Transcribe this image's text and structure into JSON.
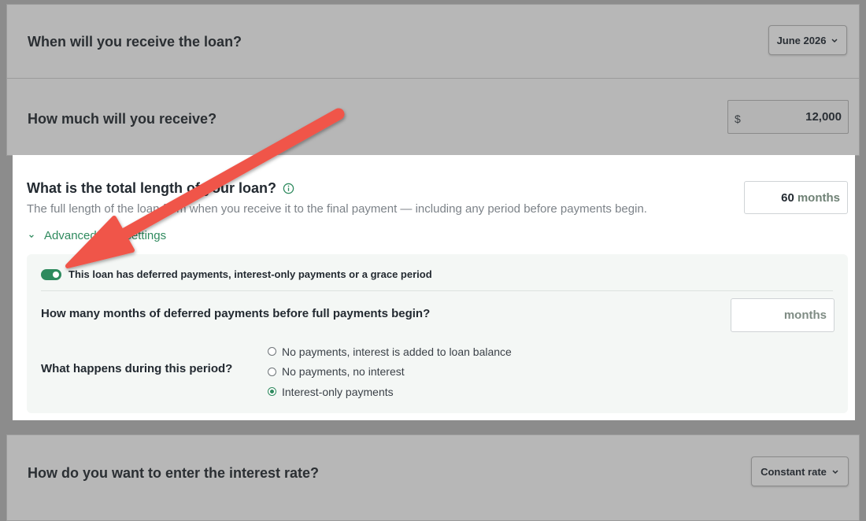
{
  "loan_date": {
    "question": "When will you receive the loan?",
    "selected": "June 2026"
  },
  "loan_amount": {
    "question": "How much will you receive?",
    "currency_symbol": "$",
    "value": "12,000"
  },
  "loan_length": {
    "question": "What is the total length of your loan?",
    "description": "The full length of the loan from when you receive it to the final payment — including any period before payments begin.",
    "value": "60",
    "unit": "months",
    "advanced_label": "Advanced loan settings"
  },
  "advanced": {
    "toggle_label": "This loan has deferred payments, interest-only payments or a grace period",
    "toggle_on": true,
    "deferred_question": "How many months of deferred payments before full payments begin?",
    "deferred_unit": "months",
    "period_question": "What happens during this period?",
    "options": [
      {
        "label": "No payments, interest is added to loan balance",
        "checked": false
      },
      {
        "label": "No payments, no interest",
        "checked": false
      },
      {
        "label": "Interest-only payments",
        "checked": true
      }
    ]
  },
  "interest": {
    "question": "How do you want to enter the interest rate?",
    "selected": "Constant rate"
  },
  "colors": {
    "accent": "#2e8a5e",
    "arrow": "#f0554a",
    "overlay": "#8c8c8c"
  }
}
